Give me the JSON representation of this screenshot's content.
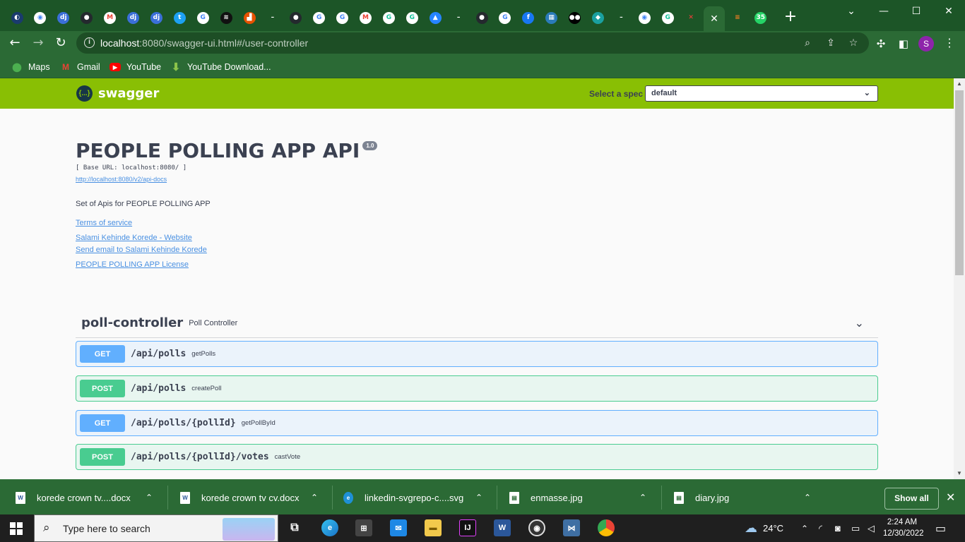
{
  "browser": {
    "url_host": "localhost",
    "url_rest": ":8080/swagger-ui.html#/user-controller",
    "active_tab_icon": "close-icon",
    "profile_initial": "S",
    "bookmarks": [
      {
        "label": "Maps",
        "icon": "maps-icon",
        "color": "#4caf50"
      },
      {
        "label": "Gmail",
        "icon": "gmail-icon",
        "color": "#ea4335"
      },
      {
        "label": "YouTube",
        "icon": "youtube-icon",
        "color": "#ff0000"
      },
      {
        "label": "YouTube Download...",
        "icon": "download-arrow-icon",
        "color": "#8bc34a"
      }
    ],
    "tab_favicons": [
      "app",
      "chrome",
      "dj",
      "github",
      "gmail",
      "dj",
      "dj",
      "twitter",
      "google",
      "spotify",
      "chart",
      "dash",
      "github",
      "google",
      "google",
      "gmail",
      "grammarly",
      "grammarly",
      "atlassian",
      "dash",
      "github",
      "google",
      "facebook",
      "repo",
      "medium",
      "diamond",
      "dash",
      "chrome",
      "grammarly",
      "x",
      "close",
      "stackoverflow",
      "whatsapp"
    ],
    "whatsapp_badge": "35"
  },
  "swagger": {
    "brand": "swagger",
    "logo_glyph": "{...}",
    "select_spec_label": "Select a spec",
    "select_spec_value": "default",
    "title": "PEOPLE POLLING APP API",
    "version": "1.0",
    "base_url": "[ Base URL: localhost:8080/ ]",
    "api_docs_link": "http://localhost:8080/v2/api-docs",
    "description": "Set of Apis for PEOPLE POLLING APP",
    "terms_link": "Terms of service",
    "website_link": "Salami Kehinde Korede - Website",
    "email_link": "Send email to Salami Kehinde Korede",
    "license_link": "PEOPLE POLLING APP License",
    "tag": {
      "name": "poll-controller",
      "description": "Poll Controller"
    },
    "operations": [
      {
        "method": "GET",
        "path": "/api/polls",
        "operation_id": "getPolls"
      },
      {
        "method": "POST",
        "path": "/api/polls",
        "operation_id": "createPoll"
      },
      {
        "method": "GET",
        "path": "/api/polls/{pollId}",
        "operation_id": "getPollById"
      },
      {
        "method": "POST",
        "path": "/api/polls/{pollId}/votes",
        "operation_id": "castVote"
      }
    ]
  },
  "downloads": {
    "items": [
      {
        "name": "korede crown tv....docx",
        "type": "word-doc-icon"
      },
      {
        "name": "korede crown tv cv.docx",
        "type": "word-doc-icon"
      },
      {
        "name": "linkedin-svgrepo-c....svg",
        "type": "edge-icon"
      },
      {
        "name": "enmasse.jpg",
        "type": "image-file-icon"
      },
      {
        "name": "diary.jpg",
        "type": "image-file-icon"
      }
    ],
    "show_all": "Show all"
  },
  "taskbar": {
    "search_placeholder": "Type here to search",
    "temperature": "24°C",
    "time": "2:24 AM",
    "date": "12/30/2022"
  }
}
